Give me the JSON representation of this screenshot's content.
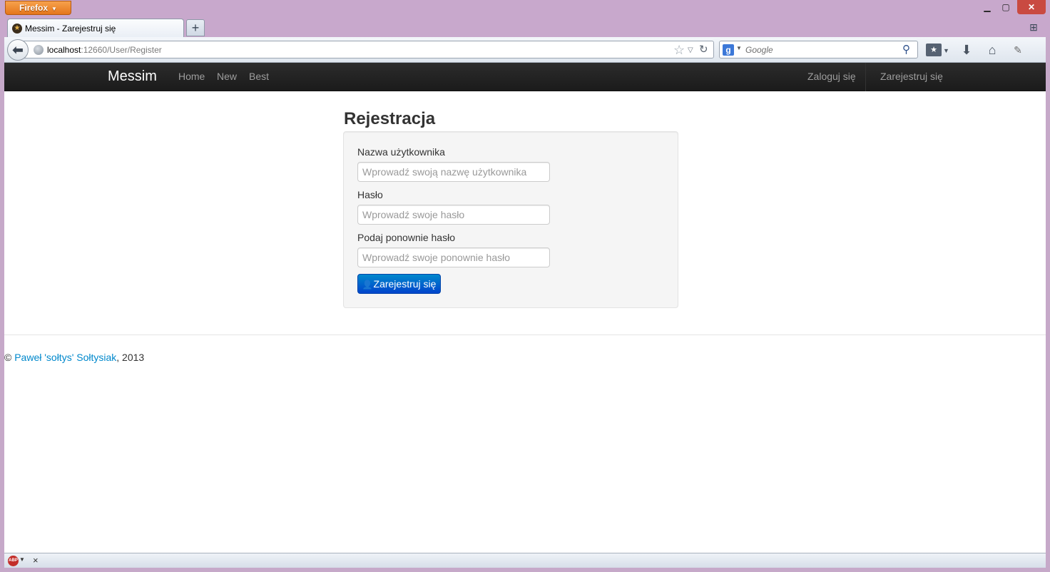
{
  "browser": {
    "app_button_label": "Firefox",
    "window_controls": {
      "minimize": "▁",
      "maximize": "▢",
      "close": "✕"
    },
    "tab": {
      "title": "Messim - Zarejestruj się"
    },
    "new_tab_label": "+",
    "url": {
      "host": "localhost",
      "rest": ":12660/User/Register"
    },
    "search": {
      "engine": "g",
      "placeholder": "Google"
    }
  },
  "site": {
    "brand": "Messim",
    "nav_left": [
      "Home",
      "New",
      "Best"
    ],
    "nav_right": [
      "Zaloguj się",
      "Zarejestruj się"
    ]
  },
  "form": {
    "heading": "Rejestracja",
    "username_label": "Nazwa użytkownika",
    "username_placeholder": "Wprowadź swoją nazwę użytkownika",
    "password_label": "Hasło",
    "password_placeholder": "Wprowadź swoje hasło",
    "password2_label": "Podaj ponownie hasło",
    "password2_placeholder": "Wprowadź swoje ponownie hasło",
    "submit_label": "Zarejestruj się"
  },
  "footer": {
    "copyright": "©",
    "author": "Paweł 'sołtys' Sołtysiak",
    "year": ", 2013"
  },
  "addon_bar": {
    "abp_label": "ABP",
    "close": "×"
  },
  "colors": {
    "accent": "#0088cc",
    "navbar": "#222222",
    "window_frame": "#c6a9c9"
  }
}
